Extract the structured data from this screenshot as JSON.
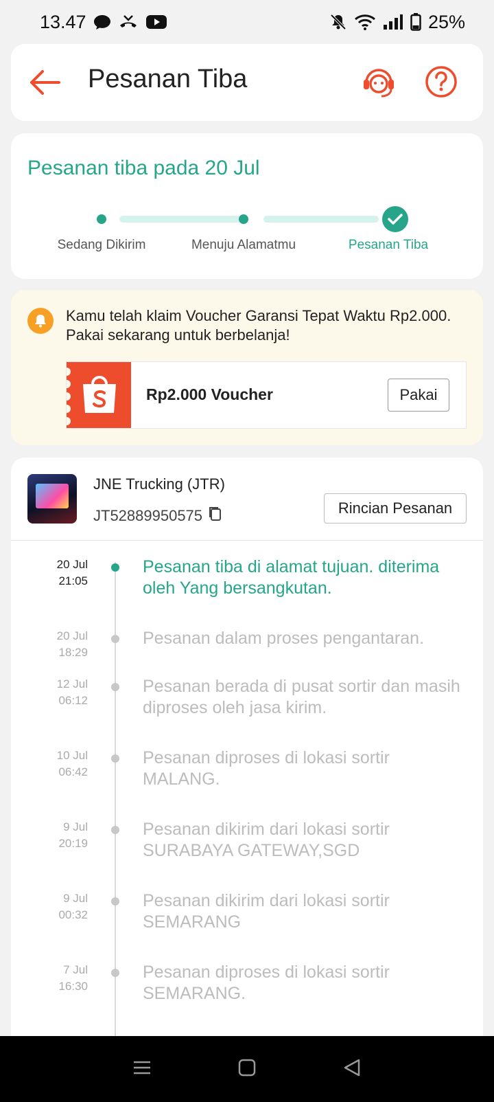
{
  "status_bar": {
    "time": "13.47",
    "battery": "25%"
  },
  "header": {
    "title": "Pesanan Tiba"
  },
  "status": {
    "heading": "Pesanan tiba pada 20 Jul",
    "steps": [
      "Sedang Dikirim",
      "Menuju Alamatmu",
      "Pesanan Tiba"
    ]
  },
  "voucher": {
    "message": "Kamu telah klaim Voucher Garansi Tepat Waktu Rp2.000. Pakai sekarang untuk berbelanja!",
    "title": "Rp2.000 Voucher",
    "button": "Pakai"
  },
  "shipment": {
    "courier": "JNE Trucking (JTR)",
    "tracking_number": "JT52889950575",
    "details_button": "Rincian Pesanan",
    "events": [
      {
        "date": "20 Jul",
        "time": "21:05",
        "desc": "Pesanan tiba di alamat tujuan. diterima oleh Yang bersangkutan."
      },
      {
        "date": "20 Jul",
        "time": "18:29",
        "desc": "Pesanan dalam proses pengantaran."
      },
      {
        "date": "12 Jul",
        "time": "06:12",
        "desc": "Pesanan berada di pusat sortir dan masih diproses oleh jasa kirim."
      },
      {
        "date": "10 Jul",
        "time": "06:42",
        "desc": "Pesanan diproses di lokasi sortir MALANG."
      },
      {
        "date": "9 Jul",
        "time": "20:19",
        "desc": "Pesanan dikirim dari lokasi sortir SURABAYA GATEWAY,SGD"
      },
      {
        "date": "9 Jul",
        "time": "00:32",
        "desc": "Pesanan dikirim dari lokasi sortir SEMARANG"
      },
      {
        "date": "7 Jul",
        "time": "16:30",
        "desc": "Pesanan diproses di lokasi sortir SEMARANG."
      }
    ]
  },
  "colors": {
    "teal": "#26a58b",
    "orange": "#ee4d2d",
    "voucher_bg": "#fdf9ea"
  }
}
